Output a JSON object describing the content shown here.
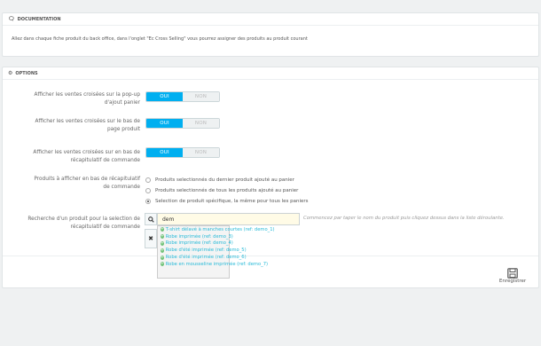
{
  "documentation": {
    "heading": "DOCUMENTATION",
    "text": "Allez dans chaque fiche produit du back office, dans l'onglet \"Ec Cross Selling\" vous pourrez assigner des produits au produit courant"
  },
  "options": {
    "heading": "OPTIONS",
    "switches": [
      {
        "label_line1": "Afficher les ventes croisées sur la pop-up",
        "label_line2": "d'ajout panier",
        "on": "OUI",
        "off": "NON",
        "value": "OUI"
      },
      {
        "label_line1": "Afficher les ventes croisées sur le bas de",
        "label_line2": "page produit",
        "on": "OUI",
        "off": "NON",
        "value": "OUI"
      },
      {
        "label_line1": "Afficher les ventes croisées sur en bas de",
        "label_line2": "récapitulatif de commande",
        "on": "OUI",
        "off": "NON",
        "value": "OUI"
      }
    ],
    "products_label_line1": "Produits à afficher en bas de récapitulatif",
    "products_label_line2": "de commande",
    "radios": [
      {
        "label": "Produits selectionnés du dernier produit ajouté au panier",
        "checked": false
      },
      {
        "label": "Produits selectionnés de tous les produits ajouté au panier",
        "checked": false
      },
      {
        "label": "Selection de produit spécifique, la même pour tous les paniers",
        "checked": true
      }
    ],
    "search_label_line1": "Recherche d'un produit pour la selection de",
    "search_label_line2": "récapitulatif de commande",
    "search_value": "dem",
    "search_hint": "Commencez par taper le nom du produit puis cliquez dessus dans la liste déroulante.",
    "results": [
      "T-shirt délavé à manches courtes (ref: demo_1)",
      "Robe imprimée (ref: demo_3)",
      "Robe imprimée (ref: demo_4)",
      "Robe d'été imprimée (ref: demo_5)",
      "Robe d'été imprimée (ref: demo_6)",
      "Robe en mousseline imprimée (ref: demo_7)"
    ],
    "save_label": "Enregistrer"
  },
  "icons": {
    "doc": "speech-bubble-icon",
    "options": "gears-icon",
    "search": "search-icon",
    "clear": "close-icon",
    "add": "plus-circle-icon",
    "save": "floppy-disk-icon"
  },
  "colors": {
    "accent": "#00aff0",
    "link": "#25b9d7",
    "add_icon": "#72c279"
  }
}
